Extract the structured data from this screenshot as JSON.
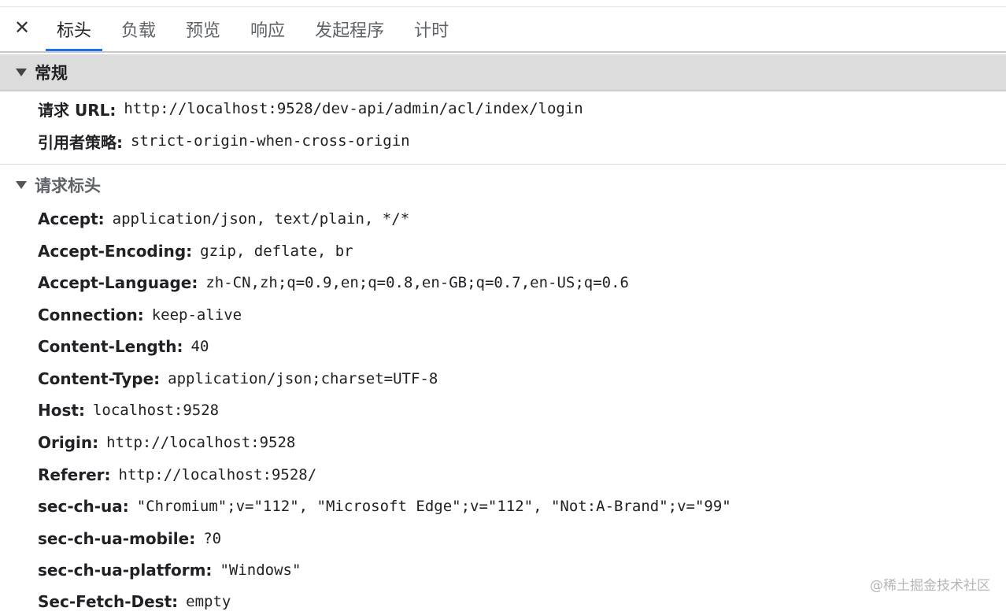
{
  "tabs": [
    {
      "label": "标头",
      "active": true
    },
    {
      "label": "负载",
      "active": false
    },
    {
      "label": "预览",
      "active": false
    },
    {
      "label": "响应",
      "active": false
    },
    {
      "label": "发起程序",
      "active": false
    },
    {
      "label": "计时",
      "active": false
    }
  ],
  "close_label": "✕",
  "general": {
    "title": "常规",
    "rows": [
      {
        "key": "请求 URL:",
        "value": "http://localhost:9528/dev-api/admin/acl/index/login"
      },
      {
        "key": "引用者策略:",
        "value": "strict-origin-when-cross-origin"
      }
    ]
  },
  "request_headers": {
    "title": "请求标头",
    "rows": [
      {
        "key": "Accept:",
        "value": "application/json, text/plain, */*"
      },
      {
        "key": "Accept-Encoding:",
        "value": "gzip, deflate, br"
      },
      {
        "key": "Accept-Language:",
        "value": "zh-CN,zh;q=0.9,en;q=0.8,en-GB;q=0.7,en-US;q=0.6"
      },
      {
        "key": "Connection:",
        "value": "keep-alive"
      },
      {
        "key": "Content-Length:",
        "value": "40"
      },
      {
        "key": "Content-Type:",
        "value": "application/json;charset=UTF-8"
      },
      {
        "key": "Host:",
        "value": "localhost:9528"
      },
      {
        "key": "Origin:",
        "value": "http://localhost:9528"
      },
      {
        "key": "Referer:",
        "value": "http://localhost:9528/"
      },
      {
        "key": "sec-ch-ua:",
        "value": "\"Chromium\";v=\"112\", \"Microsoft Edge\";v=\"112\", \"Not:A-Brand\";v=\"99\""
      },
      {
        "key": "sec-ch-ua-mobile:",
        "value": "?0"
      },
      {
        "key": "sec-ch-ua-platform:",
        "value": "\"Windows\""
      },
      {
        "key": "Sec-Fetch-Dest:",
        "value": "empty"
      }
    ]
  },
  "watermark": "@稀土掘金技术社区",
  "colors": {
    "accent": "#1a73e8",
    "section_bg": "#dcdcdc",
    "text": "#202124",
    "muted": "#5f6368"
  }
}
